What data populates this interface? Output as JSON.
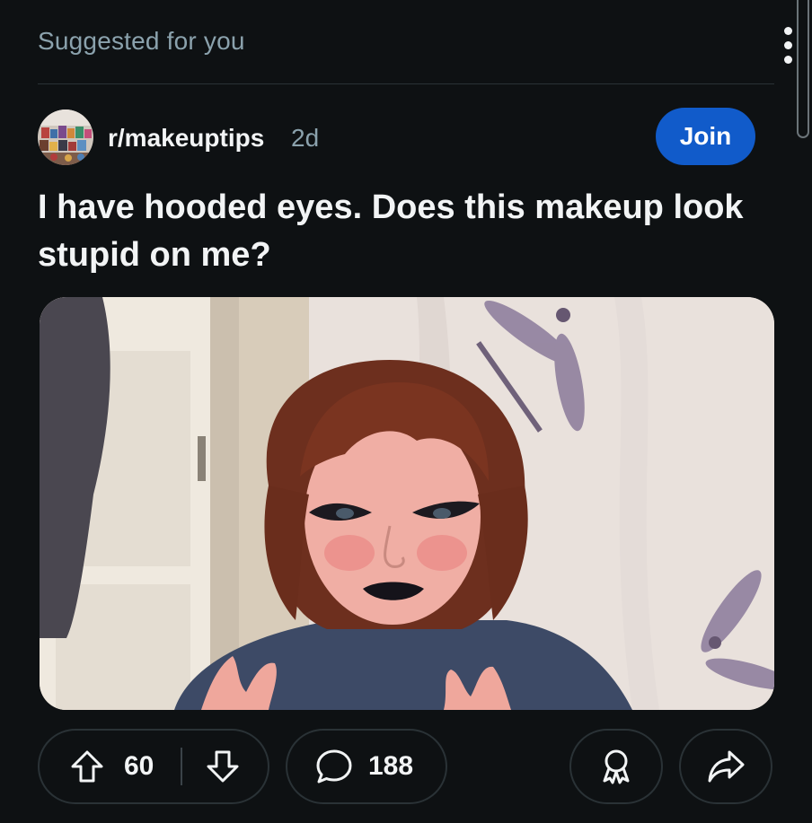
{
  "feed": {
    "section_label": "Suggested for you"
  },
  "post": {
    "subreddit": "r/makeuptips",
    "age": "2d",
    "join_label": "Join",
    "title": "I have hooded eyes. Does this makeup look stupid on me?",
    "upvotes": "60",
    "comments": "188"
  },
  "icons": {
    "more": "more-vertical-icon",
    "upvote": "arrow-up-icon",
    "downvote": "arrow-down-icon",
    "comment": "speech-bubble-icon",
    "award": "award-icon",
    "share": "share-arrow-icon"
  },
  "colors": {
    "background": "#0e1113",
    "join_button": "#115bca",
    "muted_text": "#8ba2ad",
    "primary_text": "#f2f4f5"
  }
}
